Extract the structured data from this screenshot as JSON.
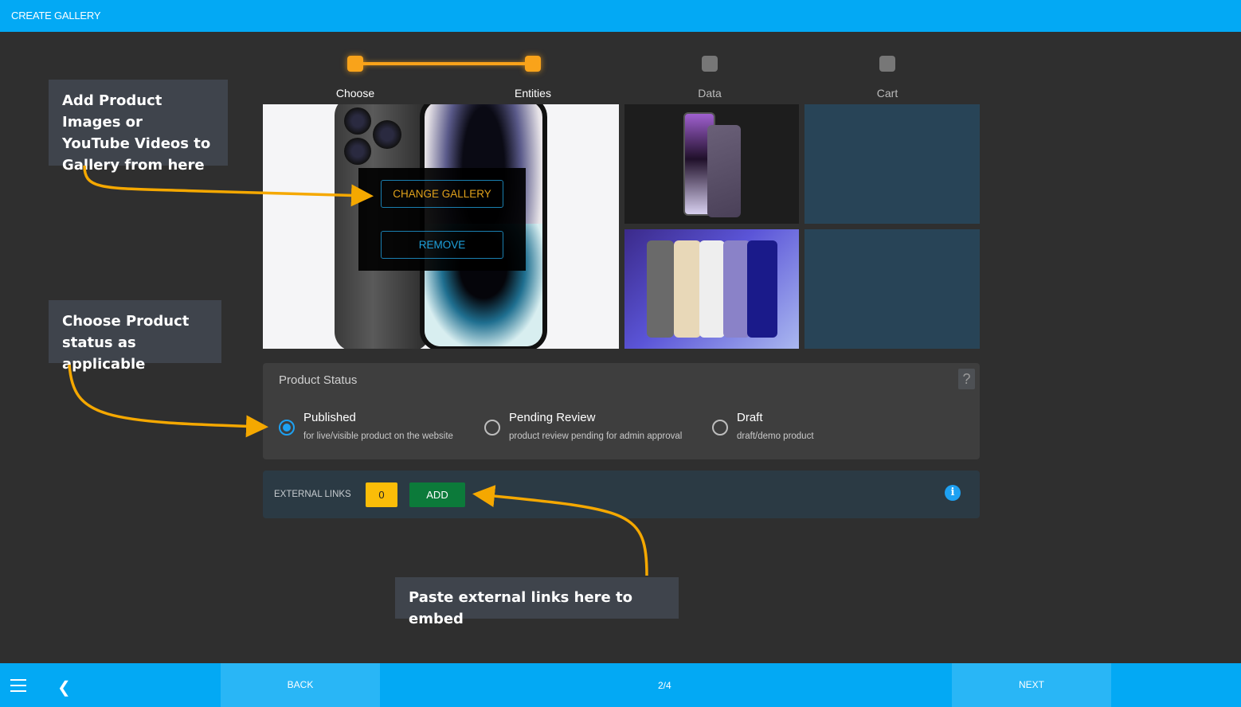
{
  "header": {
    "title": "CREATE GALLERY"
  },
  "stepper": {
    "steps": [
      {
        "label": "Choose",
        "state": "complete"
      },
      {
        "label": "Entities",
        "state": "active"
      },
      {
        "label": "Data",
        "state": "inactive"
      },
      {
        "label": "Cart",
        "state": "inactive"
      }
    ],
    "active_color": "#f9a31a"
  },
  "gallery": {
    "main_image": "iphone-14-pro-space-black",
    "overlay": {
      "change_label": "CHANGE GALLERY",
      "remove_label": "REMOVE"
    },
    "thumbnails": [
      {
        "image": "iphone-14-pro-deep-purple"
      },
      {
        "image": "iphone-lineup-colors"
      },
      {
        "image": null
      },
      {
        "image": null
      }
    ]
  },
  "product_status": {
    "title": "Product Status",
    "help_icon": "?",
    "options": [
      {
        "label": "Published",
        "description": "for live/visible product on the website",
        "checked": true
      },
      {
        "label": "Pending Review",
        "description": "product review pending for admin approval",
        "checked": false
      },
      {
        "label": "Draft",
        "description": "draft/demo product",
        "checked": false
      }
    ]
  },
  "external_links": {
    "label": "EXTERNAL LINKS",
    "count": "0",
    "add_label": "ADD",
    "info_icon": "i"
  },
  "callouts": {
    "gallery": "Add Product Images or YouTube Videos to Gallery from here",
    "status": "Choose Product status as applicable",
    "links": "Paste external links here to embed"
  },
  "footer": {
    "back_label": "BACK",
    "next_label": "NEXT",
    "page_indicator": "2/4"
  }
}
